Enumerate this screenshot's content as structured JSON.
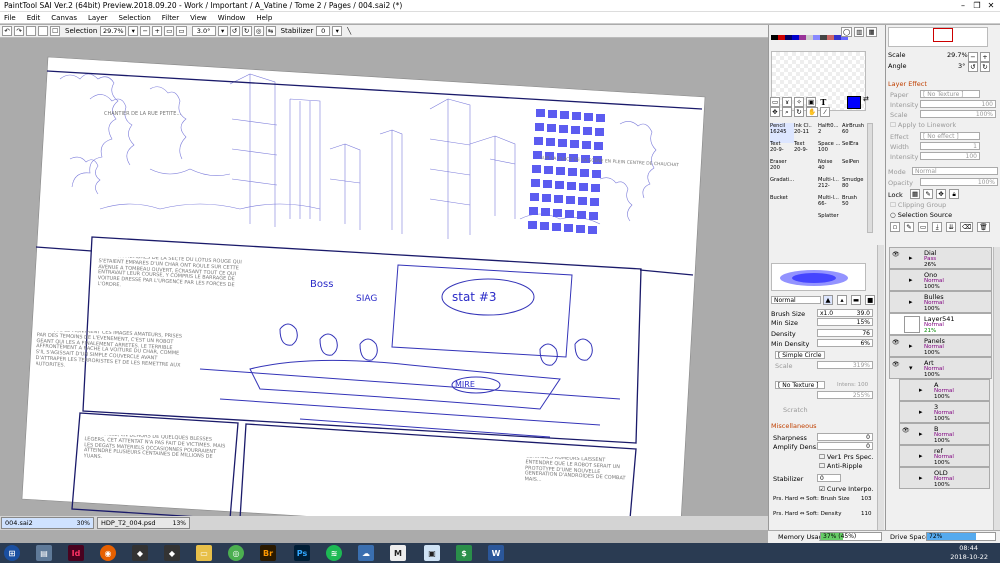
{
  "app": {
    "title": "PaintTool SAI Ver.2 (64bit) Preview.2018.09.20 - Work / Important / A_Vatine / Tome 2 / Pages / 004.sai2 (*)"
  },
  "menu": [
    "File",
    "Edit",
    "Canvas",
    "Layer",
    "Selection",
    "Filter",
    "View",
    "Window",
    "Help"
  ],
  "toolbar": {
    "selection_label": "Selection",
    "zoom": "29.7%",
    "rotation": "3.0°",
    "stabilizer_label": "Stabilizer",
    "stabilizer_value": "0"
  },
  "tabs": [
    {
      "name": "004.sai2",
      "zoom": "30%"
    },
    {
      "name": "HDP_T2_004.psd",
      "zoom": "13%"
    }
  ],
  "canvas": {
    "captions": {
      "c1": "CHANTIER DE LA RUE PETITE...",
      "c2": "SUR LA PLACE DE LA SCENE EN PLEIN CENTRE DE CHAUCHAT",
      "c3": "LES DEUX MEMBRES DE LA SECTE DU LOTUS ROUGE QUI S'ETAIENT EMPARES D'UN CHAR ONT ROULE SUR CETTE AVENUE A TOMBEAU OUVERT, ECRASANT TOUT CE QUI ENTRAVAIT LEUR COURSE, Y COMPRIS LE BARRAGE DE VOITURE DRESSE PAR L'URGENCE PAR LES FORCES DE L'ORDRE.",
      "c4": "AINSI QUE LE MONTRENT CES IMAGES AMATEURS, PRISES PAR DES TEMOINS DE L'EVENEMENT, C'EST UN ROBOT GEANT QUI LES A FINALEMENT ARRETES. LE TERRIBLE AFFRONTEMENT A RACHE LA VOITURE DU CHAR, COMME S'IL S'AGISSAIT D'UN SIMPLE COUVERCLE AVANT D'ATTRAPER LES TERRORISTES ET DE LES REMETTRE AUX AUTORITES.",
      "c5": "PAR MIRACLE, EN DEHORS DE QUELQUES BLESSES LEGERS, CET ATTENTAT N'A PAS FAIT DE VICTIMES. MAIS LES DEGATS MATERIELS OCCASIONNES POURRAIENT ATTEINDRE PLUSIEURS CENTAINES DE MILLIONS DE YUANS.",
      "c6": "CERTAINES RUMEURS LAISSENT ENTENDRE QUE LE ROBOT SERAIT UN PROTOTYPE D'UNE NOUVELLE GENERATION D'ANDROIDES DE COMBAT MAIS..."
    },
    "sketch_labels": {
      "boss": "Boss",
      "siag": "SIAG",
      "stat": "stat #3",
      "mire": "MIRE"
    }
  },
  "tools": {
    "grid": [
      {
        "name": "Pencil",
        "size": "16245"
      },
      {
        "name": "Ink Cl..",
        "size": "20-11"
      },
      {
        "name": "Halft0...",
        "size": "2"
      },
      {
        "name": "AirBrush",
        "size": "60"
      },
      {
        "name": "Text",
        "size": "20-9-"
      },
      {
        "name": "Text",
        "size": "20-9-"
      },
      {
        "name": "Space ...",
        "size": "100"
      },
      {
        "name": "SelEra",
        "size": ""
      },
      {
        "name": "Eraser",
        "size": "200"
      },
      {
        "name": "",
        "size": ""
      },
      {
        "name": "Noise",
        "size": "40"
      },
      {
        "name": "SelPen",
        "size": ""
      },
      {
        "name": "Gradati...",
        "size": ""
      },
      {
        "name": "",
        "size": ""
      },
      {
        "name": "Multi-l...",
        "size": "212-"
      },
      {
        "name": "Smudge",
        "size": "80"
      },
      {
        "name": "Bucket",
        "size": ""
      },
      {
        "name": "",
        "size": ""
      },
      {
        "name": "Multi-l...",
        "size": "66-"
      },
      {
        "name": "Brush",
        "size": "50"
      },
      {
        "name": "",
        "size": ""
      },
      {
        "name": "",
        "size": ""
      },
      {
        "name": "Splatter",
        "size": ""
      },
      {
        "name": "",
        "size": ""
      }
    ],
    "blend_mode": "Normal",
    "brush_size_label": "Brush Size",
    "brush_size_mult": "x1.0",
    "brush_size_value": "39.0",
    "min_size_label": "Min Size",
    "min_size_value": "15%",
    "density_label": "Density",
    "density_value": "76",
    "min_density_label": "Min Density",
    "min_density_value": "6%",
    "shape": "[ Simple Circle ]",
    "scale_label": "Scale",
    "scale_value": "319%",
    "texture": "[ No Texture ]",
    "texture_intensity": "Intens: 100",
    "texture_scale": "255%",
    "scratch_label": "Scratch",
    "misc_label": "Miscellaneous",
    "sharpness_label": "Sharpness",
    "sharpness_value": "0",
    "amplify_label": "Amplify Dens.",
    "amplify_value": "0",
    "ver1_label": "Ver1 Prs Spec.",
    "anti_ripple_label": "Anti-Ripple",
    "stabilizer_label": "Stabilizer",
    "stabilizer_value": "0",
    "curve_label": "Curve Interpo.",
    "prs_brush_label": "Prs. Hard ⇔ Soft: Brush Size",
    "prs_brush_value": "103",
    "prs_density_label": "Prs. Hard ⇔ Soft: Density",
    "prs_density_value": "110"
  },
  "navigator": {
    "scale_label": "Scale",
    "scale_value": "29.7%",
    "angle_label": "Angle",
    "angle_value": "3°"
  },
  "layer_effect": {
    "title": "Layer Effect",
    "paper_label": "Paper",
    "paper_value": "[ No Texture ]",
    "intensity_label": "Intensity",
    "intensity_value": "100",
    "scale_label": "Scale",
    "scale_value": "100%",
    "apply_label": "Apply to Linework",
    "effect_label": "Effect",
    "effect_value": "[ No effect ]",
    "width_label": "Width",
    "width_value": "1",
    "eff_intensity_label": "Intensity",
    "eff_intensity_value": "100"
  },
  "layer_props": {
    "mode_label": "Mode",
    "mode_value": "Normal",
    "opacity_label": "Opacity",
    "opacity_value": "100%",
    "lock_label": "Lock",
    "clipping_label": "Clipping Group",
    "selection_source_label": "Selection Source"
  },
  "layers": [
    {
      "name": "Dial",
      "mode": "Pass",
      "opacity": "26%",
      "folder": true
    },
    {
      "name": "Ono",
      "mode": "Normal",
      "opacity": "100%",
      "folder": true
    },
    {
      "name": "Bulles",
      "mode": "Normal",
      "opacity": "100%",
      "folder": true
    },
    {
      "name": "Layer541",
      "mode": "Normal",
      "opacity": "21%",
      "folder": false
    },
    {
      "name": "Panels",
      "mode": "Normal",
      "opacity": "100%",
      "folder": true
    },
    {
      "name": "Art",
      "mode": "Normal",
      "opacity": "100%",
      "folder": true
    },
    {
      "name": "A",
      "mode": "Normal",
      "opacity": "100%",
      "folder": true
    },
    {
      "name": "3",
      "mode": "Normal",
      "opacity": "100%",
      "folder": true
    },
    {
      "name": "B",
      "mode": "Normal",
      "opacity": "100%",
      "folder": true
    },
    {
      "name": "ref",
      "mode": "Normal",
      "opacity": "100%",
      "folder": true
    },
    {
      "name": "OLD",
      "mode": "Normal",
      "opacity": "100%",
      "folder": true
    }
  ],
  "status": {
    "memory_label": "Memory Usage",
    "memory_value": "37% (45%)",
    "drive_label": "Drive Space",
    "drive_value": "72%"
  },
  "taskbar": {
    "time": "08:44",
    "date": "2018-10-22"
  },
  "colors": {
    "accent_blue": "#2a2aff",
    "sketch_blue": "#4b4bd6",
    "panel_orange": "#c04000"
  }
}
